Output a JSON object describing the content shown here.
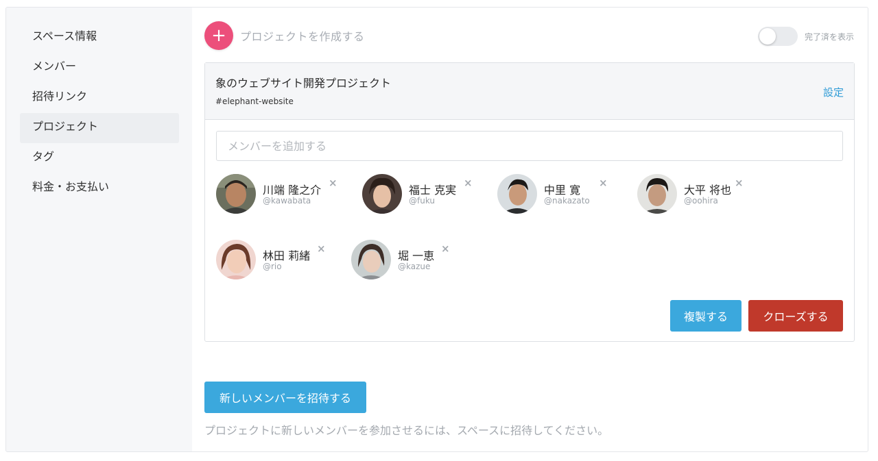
{
  "sidebar": {
    "items": [
      {
        "label": "スペース情報"
      },
      {
        "label": "メンバー"
      },
      {
        "label": "招待リンク"
      },
      {
        "label": "プロジェクト"
      },
      {
        "label": "タグ"
      },
      {
        "label": "料金・お支払い"
      }
    ],
    "active_index": 3
  },
  "toolbar": {
    "create_icon": "+",
    "create_label": "プロジェクトを作成する",
    "show_completed_label": "完了済を表示",
    "show_completed_on": false
  },
  "project": {
    "title": "象のウェブサイト開発プロジェクト",
    "slug": "#elephant-website",
    "settings_label": "設定",
    "add_member_placeholder": "メンバーを追加する",
    "members": [
      {
        "name": "川端 隆之介",
        "handle": "@kawabata",
        "remove": "×"
      },
      {
        "name": "福士 克実",
        "handle": "@fuku",
        "remove": "×"
      },
      {
        "name": "中里 寛",
        "handle": "@nakazato",
        "remove": "×"
      },
      {
        "name": "大平 将也",
        "handle": "@oohira",
        "remove": "×"
      },
      {
        "name": "林田 莉緒",
        "handle": "@rio",
        "remove": "×"
      },
      {
        "name": "堀 一恵",
        "handle": "@kazue",
        "remove": "×"
      }
    ],
    "duplicate_label": "複製する",
    "close_label": "クローズする"
  },
  "invite": {
    "button_label": "新しいメンバーを招待する",
    "note": "プロジェクトに新しいメンバーを参加させるには、スペースに招待してください。"
  },
  "colors": {
    "accent_pink": "#ec4f7b",
    "link_blue": "#2e9bd6",
    "button_blue": "#3ba8dd",
    "danger_red": "#c0392b"
  }
}
